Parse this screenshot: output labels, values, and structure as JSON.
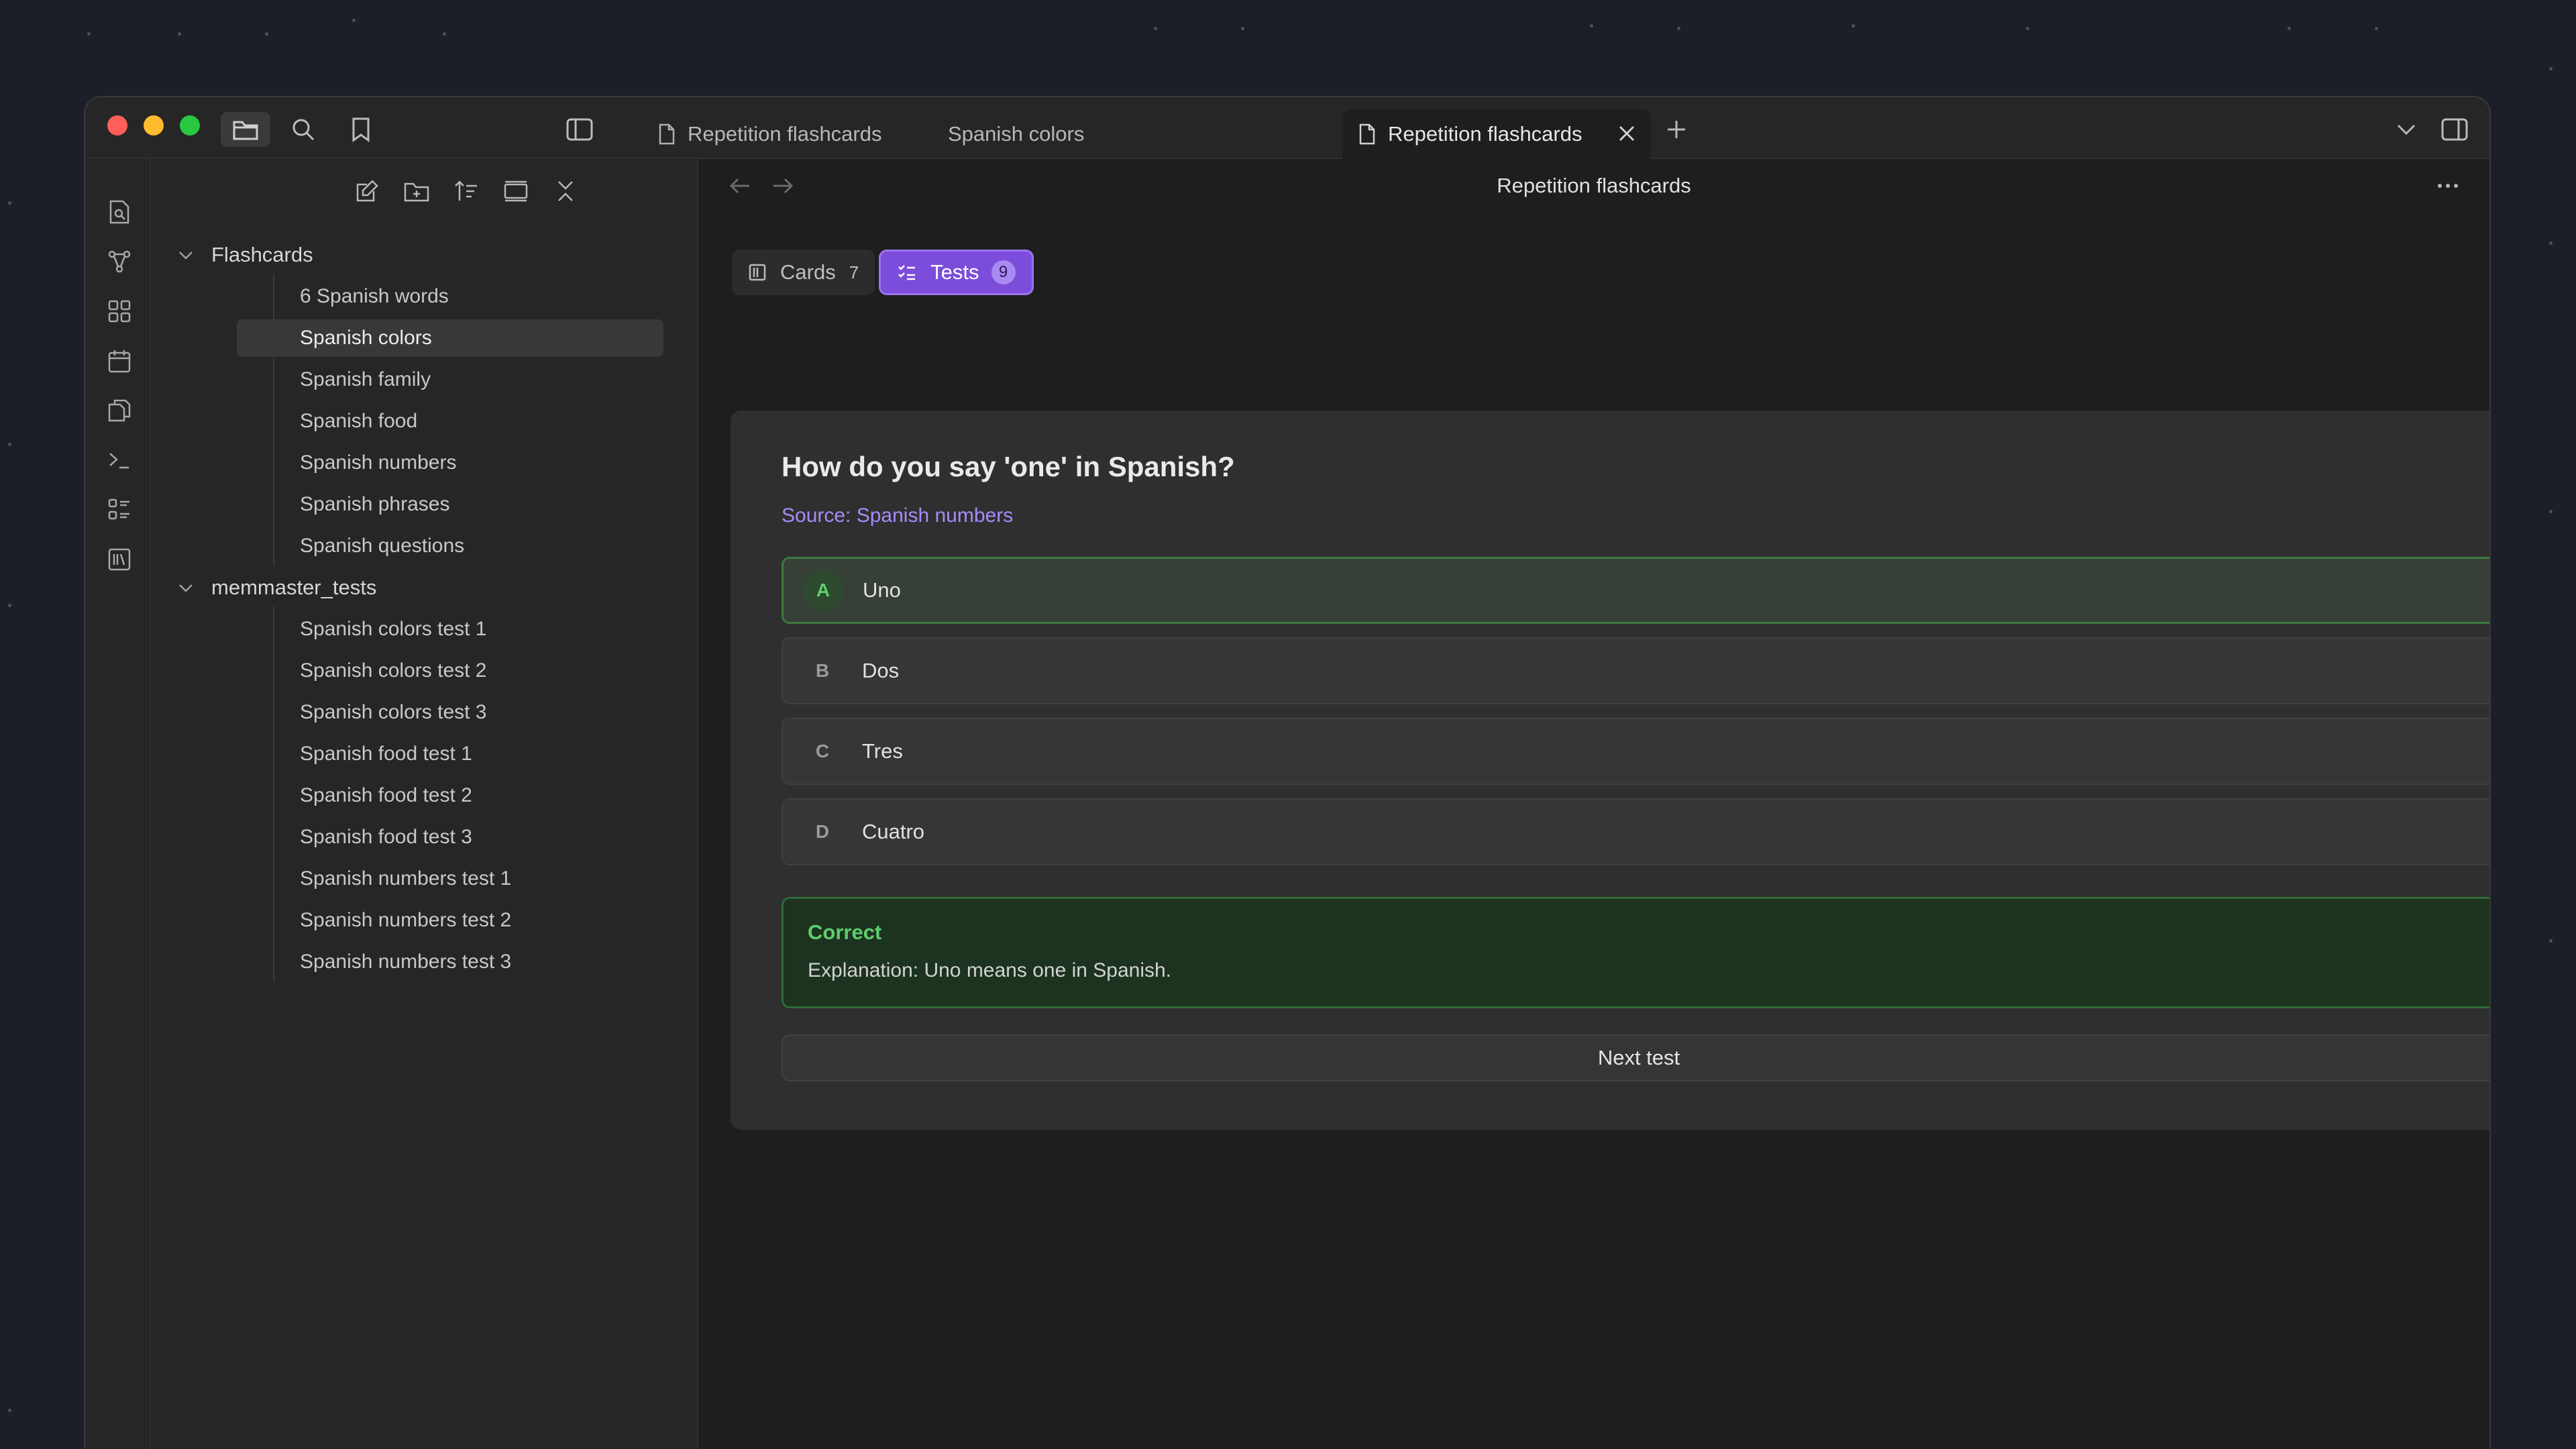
{
  "colors": {
    "accent": "#7c4ddb",
    "correct": "#5ccf6b",
    "link": "#a78bfa"
  },
  "tabs": [
    {
      "label": "Repetition flashcards",
      "icon": "file-icon"
    },
    {
      "label": "Spanish colors"
    },
    {
      "label": "Repetition flashcards",
      "icon": "file-icon",
      "active": true
    }
  ],
  "sidebar": {
    "folders": [
      {
        "label": "Flashcards",
        "expanded": true,
        "items": [
          "6 Spanish words",
          "Spanish colors",
          "Spanish family",
          "Spanish food",
          "Spanish numbers",
          "Spanish phrases",
          "Spanish questions"
        ]
      },
      {
        "label": "memmaster_tests",
        "expanded": true,
        "items": [
          "Spanish colors test 1",
          "Spanish colors test 2",
          "Spanish colors test 3",
          "Spanish food test 1",
          "Spanish food test 2",
          "Spanish food test 3",
          "Spanish numbers test 1",
          "Spanish numbers test 2",
          "Spanish numbers test 3"
        ]
      }
    ],
    "selected": "Spanish colors"
  },
  "view": {
    "title": "Repetition flashcards",
    "modes": {
      "cards": {
        "label": "Cards",
        "count": "7"
      },
      "tests": {
        "label": "Tests",
        "count": "9",
        "active": true
      }
    }
  },
  "quiz": {
    "question": "How do you say 'one' in Spanish?",
    "source": "Source: Spanish numbers",
    "options": [
      {
        "letter": "A",
        "text": "Uno",
        "correct": true
      },
      {
        "letter": "B",
        "text": "Dos"
      },
      {
        "letter": "C",
        "text": "Tres"
      },
      {
        "letter": "D",
        "text": "Cuatro"
      }
    ],
    "result_title": "Correct",
    "result_explanation": "Explanation: Uno means one in Spanish.",
    "next_label": "Next test"
  }
}
